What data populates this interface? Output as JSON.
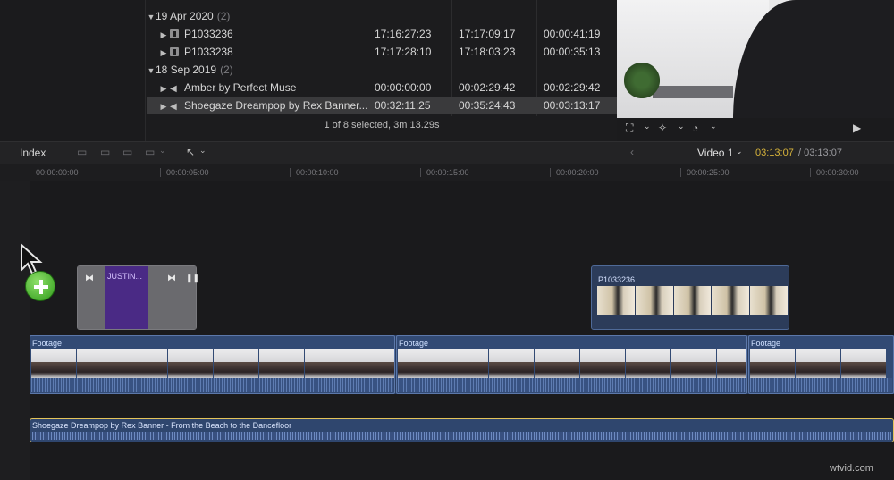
{
  "browser": {
    "events": [
      {
        "label": "19 Apr 2020",
        "count": "(2)",
        "clips": [
          {
            "name": "P1033236",
            "c1": "17:16:27:23",
            "c2": "17:17:09:17",
            "c3": "00:00:41:19"
          },
          {
            "name": "P1033238",
            "c1": "17:17:28:10",
            "c2": "17:18:03:23",
            "c3": "00:00:35:13"
          }
        ]
      },
      {
        "label": "18 Sep 2019",
        "count": "(2)",
        "clips": [
          {
            "name": "Amber by Perfect Muse",
            "c1": "00:00:00:00",
            "c2": "00:02:29:42",
            "c3": "00:02:29:42"
          },
          {
            "name": "Shoegaze Dreampop by Rex Banner...",
            "c1": "00:32:11:25",
            "c2": "00:35:24:43",
            "c3": "00:03:13:17"
          }
        ]
      }
    ],
    "status": "1 of 8 selected, 3m 13.29s"
  },
  "timeline": {
    "index_label": "Index",
    "project_name": "Video 1",
    "timecode_current": "03:13:07",
    "timecode_total": "/ 03:13:07",
    "ruler": [
      "00:00:00:00",
      "00:00:05:00",
      "00:00:10:00",
      "00:00:15:00",
      "00:00:20:00",
      "00:00:25:00",
      "00:00:30:00"
    ],
    "title_clip_label": "JUSTIN...",
    "connected_clip_label": "P1033236",
    "primary_clips": [
      "Footage",
      "Footage",
      "Footage"
    ],
    "audio_clip_label": "Shoegaze Dreampop by Rex Banner - From the Beach to the Dancefloor"
  },
  "watermark": "wtvid.com"
}
